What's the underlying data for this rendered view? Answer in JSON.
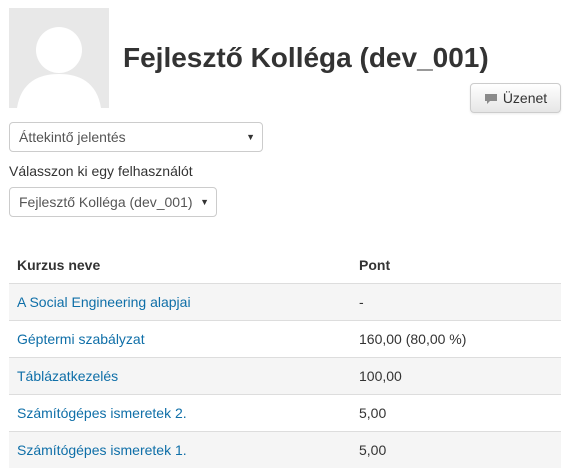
{
  "profile": {
    "full_name": "Fejlesztő Kolléga (dev_001)",
    "message_button": "Üzenet"
  },
  "report_select": {
    "selected": "Áttekintő jelentés"
  },
  "user_select": {
    "label": "Válasszon ki egy felhasználót",
    "selected": "Fejlesztő Kolléga (dev_001)"
  },
  "grades_table": {
    "headers": [
      "Kurzus neve",
      "Pont"
    ],
    "rows": [
      {
        "course": "A Social Engineering alapjai",
        "grade": "-"
      },
      {
        "course": "Géptermi szabályzat",
        "grade": "160,00 (80,00 %)"
      },
      {
        "course": "Táblázatkezelés",
        "grade": "100,00"
      },
      {
        "course": "Számítógépes ismeretek 2.",
        "grade": "5,00"
      },
      {
        "course": "Számítógépes ismeretek 1.",
        "grade": "5,00"
      }
    ]
  },
  "icons": {
    "avatar": "default-user-avatar",
    "message": "speech-bubble-icon",
    "dropdown": "caret-down-icon"
  },
  "colors": {
    "link": "#0f6fa8",
    "stripe": "#f5f5f5",
    "avatar_bg": "#e8e8e8"
  }
}
